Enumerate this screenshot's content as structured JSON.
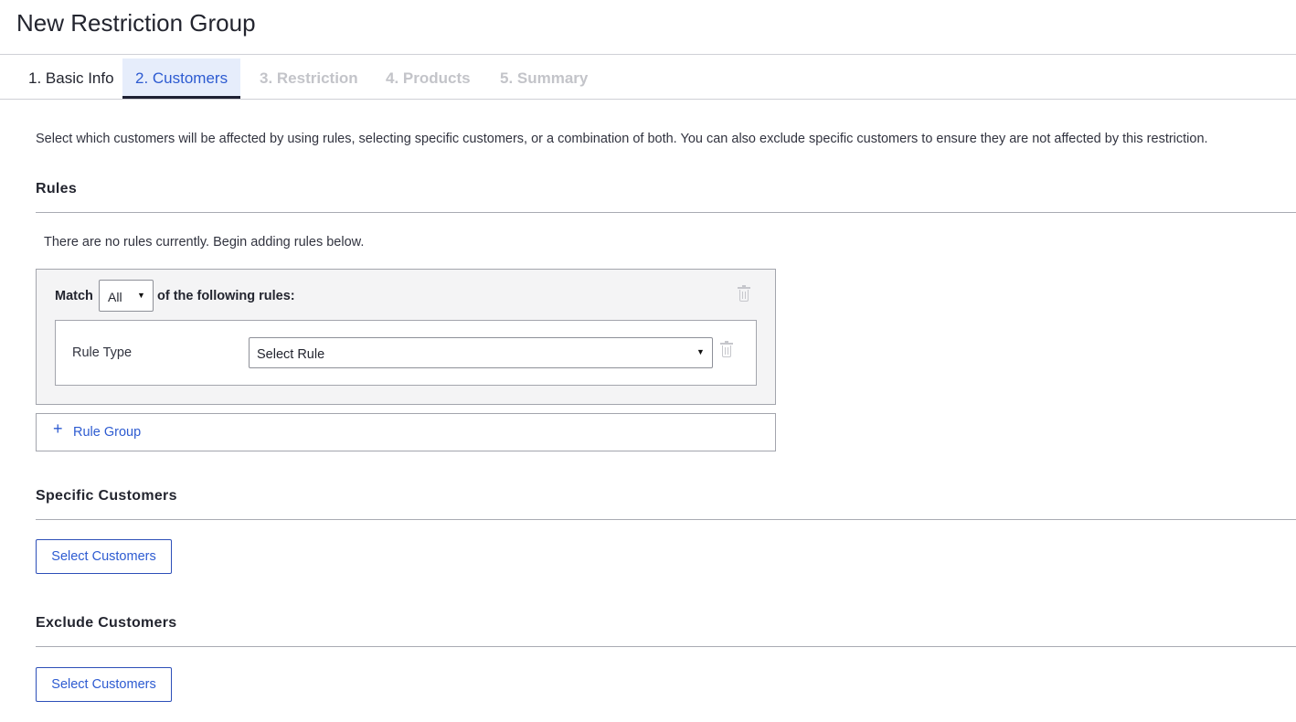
{
  "page": {
    "title": "New Restriction Group"
  },
  "tabs": [
    {
      "label": "1. Basic Info",
      "state": "done"
    },
    {
      "label": "2. Customers",
      "state": "active"
    },
    {
      "label": "3. Restriction",
      "state": "disabled"
    },
    {
      "label": "4. Products",
      "state": "disabled"
    },
    {
      "label": "5. Summary",
      "state": "disabled"
    }
  ],
  "intro": "Select which customers will be affected by using rules, selecting specific customers, or a combination of both. You can also exclude specific customers to ensure they are not affected by this restriction.",
  "rules": {
    "title": "Rules",
    "empty_note": "There are no rules currently. Begin adding rules below.",
    "group": {
      "match_label": "Match",
      "match_value": "All",
      "match_suffix": "of the following rules:",
      "rule_type_label": "Rule Type",
      "rule_select_value": "Select Rule"
    },
    "add_group_label": "Rule Group"
  },
  "specific": {
    "title": "Specific Customers",
    "button": "Select Customers"
  },
  "exclude": {
    "title": "Exclude Customers",
    "button": "Select Customers"
  },
  "colors": {
    "accent": "#2d5bd1",
    "active_tab_bg": "#e6edfb",
    "disabled_tab": "#c3c4c9"
  }
}
